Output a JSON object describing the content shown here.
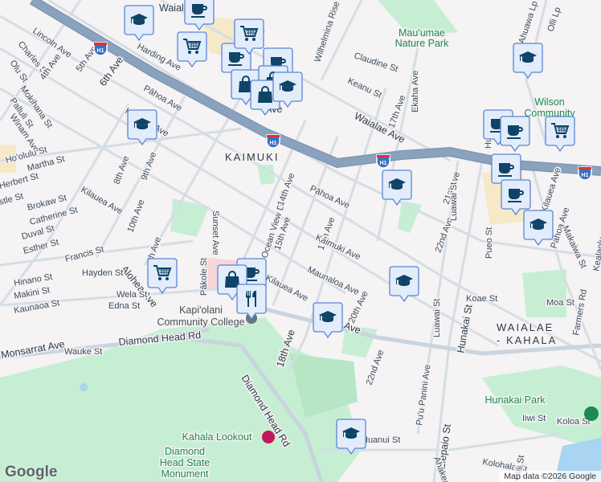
{
  "map": {
    "attribution": "Map data ©2026 Google",
    "logo": "Google",
    "highway_shield": "H1",
    "areas": [
      "KAIMUKI",
      "WAIALAE",
      "- KAHALA"
    ],
    "pois": {
      "mauumae_1": "Mau'umae",
      "mauumae_2": "Nature Park",
      "wilson_1": "Wilson",
      "wilson_2": "Community",
      "hunakai_park": "Hunakai Park",
      "kcc_1": "Kapi'olani",
      "kcc_2": "Community College",
      "kahala_lookout": "Kahala Lookout",
      "dh_1": "Diamond",
      "dh_2": "Head State",
      "dh_3": "Monument"
    },
    "streets": [
      "Lincoln Ave",
      "Charles St",
      "Olu St",
      "4th Ave",
      "Mokihana St",
      "Palluli St",
      "Winam Ave",
      "5th Ave",
      "Harding Ave",
      "6th Ave",
      "Pāhoa Ave",
      "Kaimuki Ave",
      "Ho'olulu St",
      "Martha St",
      "Herbert St",
      "stle St",
      "8th Ave",
      "9th Ave",
      "Kilauea Ave",
      "Brokaw St",
      "Catherine St",
      "Duval St",
      "Esther St",
      "Francis St",
      "10th Ave",
      "Alohea Ave",
      "th Ave",
      "Hayden St",
      "Wela St",
      "Edna St",
      "Hinano St",
      "Makini St",
      "Kaunaoa St",
      "Monsarrat Ave",
      "Wauke St",
      "Diamond Head Rd",
      "Diamond Head Rd",
      "Pākole St",
      "Sunset Ave",
      "Ocean View Dr",
      "14th Ave",
      "15th Ave",
      "17th Ave",
      "18th Ave",
      "Kilauea Ave",
      "Maunaloa Ave",
      "Kaimuki Ave",
      "Pāhoa Ave",
      "Waialae Ave",
      "a Ave",
      "20th Ave",
      "22nd Ave",
      "22nd Ave",
      "21st Ave",
      "Luawai St",
      "Luawai St",
      "Hunakai St",
      "Elepaio St",
      "Pu'u Panini Ave",
      "Huanui St",
      "Koae St",
      "Ahakea St",
      "Kolohala St",
      "Ulili St",
      "Iiwi St",
      "Koloa St",
      "Farmers Rd",
      "Moa St",
      "Pahoa Ave",
      "Kilauea Ave",
      "Kealaolu",
      "Pueo St",
      "Makaiwa St",
      "Claudine St",
      "Keanu St",
      "Ekaha Ave",
      "17th Ave",
      "Wilhelmina Rise",
      "Ahuawa Lp",
      "Olli Lp",
      "Hu",
      "Waialae",
      "Dr",
      "Ave"
    ],
    "markers": [
      "cup",
      "school",
      "cup",
      "cart",
      "cart",
      "cup",
      "bag",
      "bag",
      "bag",
      "school",
      "school",
      "school",
      "school",
      "cup",
      "cup",
      "cart",
      "cup",
      "cup",
      "school",
      "cart",
      "cup",
      "bag",
      "fork",
      "school",
      "school",
      "school"
    ]
  },
  "colors": {
    "marker_fill": "#e2ecfb",
    "marker_border": "#5a86d4",
    "marker_icon": "#0f4467",
    "highway": "#8aa2bd",
    "park": "#c6eed3"
  }
}
